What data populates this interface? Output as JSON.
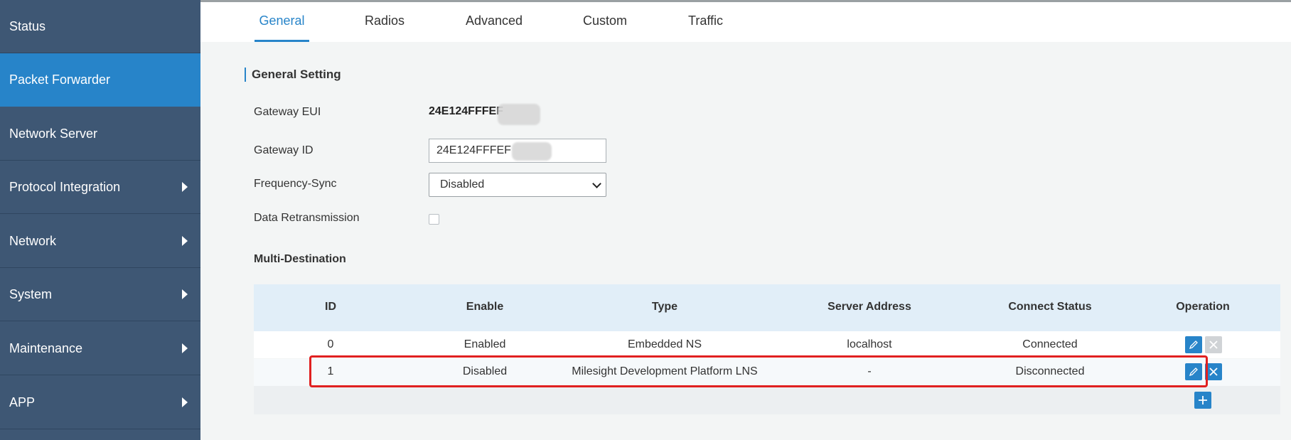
{
  "sidebar": {
    "items": [
      {
        "label": "Status"
      },
      {
        "label": "Packet Forwarder"
      },
      {
        "label": "Network Server"
      },
      {
        "label": "Protocol Integration"
      },
      {
        "label": "Network"
      },
      {
        "label": "System"
      },
      {
        "label": "Maintenance"
      },
      {
        "label": "APP"
      }
    ]
  },
  "tabs": [
    "General",
    "Radios",
    "Advanced",
    "Custom",
    "Traffic"
  ],
  "general": {
    "section_title": "General Setting",
    "gateway_eui_label": "Gateway EUI",
    "gateway_eui_value": "24E124FFFEF",
    "gateway_id_label": "Gateway ID",
    "gateway_id_value": "24E124FFFEF",
    "frequency_sync_label": "Frequency-Sync",
    "frequency_sync_value": "Disabled",
    "data_retransmission_label": "Data Retransmission"
  },
  "multi_destination": {
    "title": "Multi-Destination",
    "columns": [
      "ID",
      "Enable",
      "Type",
      "Server Address",
      "Connect Status",
      "Operation"
    ],
    "rows": [
      {
        "id": "0",
        "enable": "Enabled",
        "type": "Embedded NS",
        "server": "localhost",
        "status": "Connected"
      },
      {
        "id": "1",
        "enable": "Disabled",
        "type": "Milesight Development Platform LNS",
        "server": "-",
        "status": "Disconnected"
      }
    ]
  },
  "icons": {
    "edit": "pencil-icon",
    "delete": "close-icon",
    "add": "plus-icon",
    "submenu": "triangle-right-icon"
  },
  "colors": {
    "sidebar_bg": "#3e5774",
    "accent": "#2784c9",
    "highlight": "#e02020"
  }
}
